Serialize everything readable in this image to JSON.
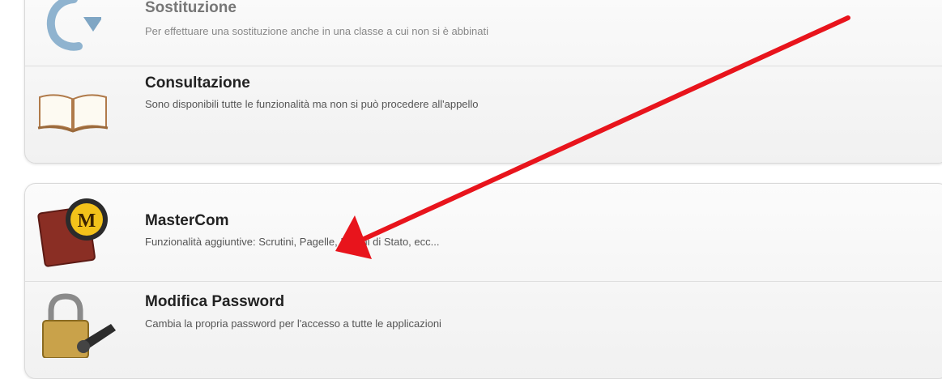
{
  "items": [
    {
      "title": "Sostituzione",
      "description": "Per effettuare una sostituzione anche in una classe a cui non si è abbinati",
      "icon": "refresh-arrows-icon"
    },
    {
      "title": "Consultazione",
      "description": "Sono disponibili tutte le funzionalità ma non si può procedere all'appello",
      "icon": "open-book-icon"
    },
    {
      "title": "MasterCom",
      "description": "Funzionalità aggiuntive: Scrutini, Pagelle, Esami di Stato, ecc...",
      "icon": "mastercom-logo-icon",
      "logo_letter": "M"
    },
    {
      "title": "Modifica Password",
      "description": "Cambia la propria password per l'accesso a tutte le applicazioni",
      "icon": "padlock-key-icon"
    }
  ],
  "annotation": {
    "color": "#e8141c"
  }
}
